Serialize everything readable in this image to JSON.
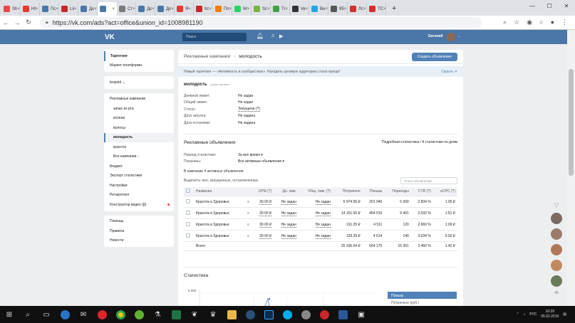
{
  "browser": {
    "tabs": [
      {
        "label": "Sh",
        "color": "#e5474b"
      },
      {
        "label": "Ht",
        "color": "#e53935"
      },
      {
        "label": "Пс",
        "color": "#4a76a8"
      },
      {
        "label": "Lii",
        "color": "#c62828"
      },
      {
        "label": "Дє",
        "color": "#4a76a8"
      },
      {
        "label": "",
        "color": "#4a76a8",
        "active": true
      },
      {
        "label": "Ст",
        "color": "#7a7a7a"
      },
      {
        "label": "Дє",
        "color": "#4a76a8"
      },
      {
        "label": "Дє",
        "color": "#4a76a8"
      },
      {
        "label": "Я",
        "color": "#e53935"
      },
      {
        "label": "Кс",
        "color": "#c62828"
      },
      {
        "label": "Пп",
        "color": "#f57c00"
      },
      {
        "label": "W",
        "color": "#25d366"
      },
      {
        "label": "Sc",
        "color": "#7cb342"
      },
      {
        "label": "Tr",
        "color": "#43a047"
      },
      {
        "label": "Ve",
        "color": "#333333"
      },
      {
        "label": "Ве",
        "color": "#2aa3e0"
      },
      {
        "label": "95",
        "color": "#555555"
      },
      {
        "label": "Лс",
        "color": "#d32f2f"
      },
      {
        "label": "TC",
        "color": "#d32f2f"
      }
    ],
    "url": "https://vk.com/ads?act=office&union_id=1008981190",
    "win_min": "—",
    "win_max": "☐",
    "win_close": "✕"
  },
  "vk": {
    "logo": "VK",
    "search_placeholder": "Поиск",
    "user_name": "Евгений"
  },
  "sidebar": {
    "group1": [
      "Таргетинг",
      "Маркет-платформа"
    ],
    "account": "leopold ⌄",
    "campaigns_label": "Рекламные кампании",
    "campaigns": [
      "запах из рта",
      "колени",
      "волосы",
      "молодость",
      "красота",
      "Все кампании ↓"
    ],
    "tools": [
      "Бюджет",
      "Экспорт статистики",
      "Настройки",
      "Ретаргетинг",
      "Конструктор видео (β)"
    ],
    "help": [
      "Помощь",
      "Правила",
      "Новости"
    ]
  },
  "header": {
    "crumb": "Рекламные кампании",
    "sep": "›",
    "current": "молодость",
    "create_button": "Создать объявление"
  },
  "banner": {
    "text": "Новый таргетинг — «Активность в сообществах». Находить целевую аудиторию стало проще!",
    "hide": "Скрыть ✕"
  },
  "campaign": {
    "name": "молодость",
    "status": "редактировать",
    "props": [
      {
        "k": "Дневной лимит:",
        "v": "Не задан"
      },
      {
        "k": "Общий лимит:",
        "v": "Не задан"
      },
      {
        "k": "Статус:",
        "v": "Запущена (?)"
      },
      {
        "k": "Дата запуска:",
        "v": "Не задана"
      },
      {
        "k": "Дата остановки:",
        "v": "Не задана"
      }
    ]
  },
  "ads": {
    "title": "Рекламные объявления",
    "links": "Подробная статистика / К статистике по дням",
    "period_label": "Период статистики:",
    "period_value": "За всё время ▾",
    "shown_label": "Показаны:",
    "shown_value": "Все активные объявления ▾",
    "note": "В кампании 4 активных объявления",
    "select": "Выделить: все, запущенные, остановленные",
    "search_placeholder": "Поиск объявлений",
    "columns": [
      "Название",
      "CPM (?)",
      "Дн. лим.",
      "Общ. лим. (?)",
      "Потрачено",
      "Показы",
      "Переходы",
      "CTR (?)",
      "eCPC (?)"
    ],
    "rows": [
      {
        "name": "Красота и Здоровье",
        "cpm": "30.00 ₽",
        "day": "Не задан",
        "total": "Не задан",
        "spent": "5 974.50 ₽",
        "views": "201 040",
        "clicks": "5 690",
        "ctr": "2.834 %",
        "ecpc": "1.05 ₽"
      },
      {
        "name": "Красота и Здоровье",
        "cpm": "30.00 ₽",
        "day": "Не задан",
        "total": "Не задан",
        "spent": "14 101.50 ₽",
        "views": "454 010",
        "clicks": "9 401",
        "ctr": "2.033 %",
        "ecpc": "1.51 ₽"
      },
      {
        "name": "Красота и Здоровье",
        "cpm": "30.00 ₽",
        "day": "Не задан",
        "total": "Не задан",
        "spent": "131.25 ₽",
        "views": "4 511",
        "clicks": "120",
        "ctr": "2.660 %",
        "ecpc": "1.09 ₽"
      },
      {
        "name": "Красота и Здоровье",
        "cpm": "30.00 ₽",
        "day": "Не задан",
        "total": "Не задан",
        "spent": "129.39 ₽",
        "views": "4 614",
        "clicks": "140",
        "ctr": "3.034 %",
        "ecpc": "0.92 ₽"
      }
    ],
    "total": {
      "name": "Всего",
      "spent": "20 336.64 ₽",
      "views": "664 175",
      "clicks": "15 351",
      "ctr": "2.460 %",
      "ecpc": "1.42 ₽"
    }
  },
  "stats": {
    "title": "Статистика",
    "ytick": "5 000",
    "legend": [
      "Показы",
      "Потрачено (руб.)"
    ]
  },
  "chat": {
    "count": "40"
  },
  "taskbar": {
    "lang": "РУС",
    "time": "16:39",
    "date": "05.02.2019"
  }
}
